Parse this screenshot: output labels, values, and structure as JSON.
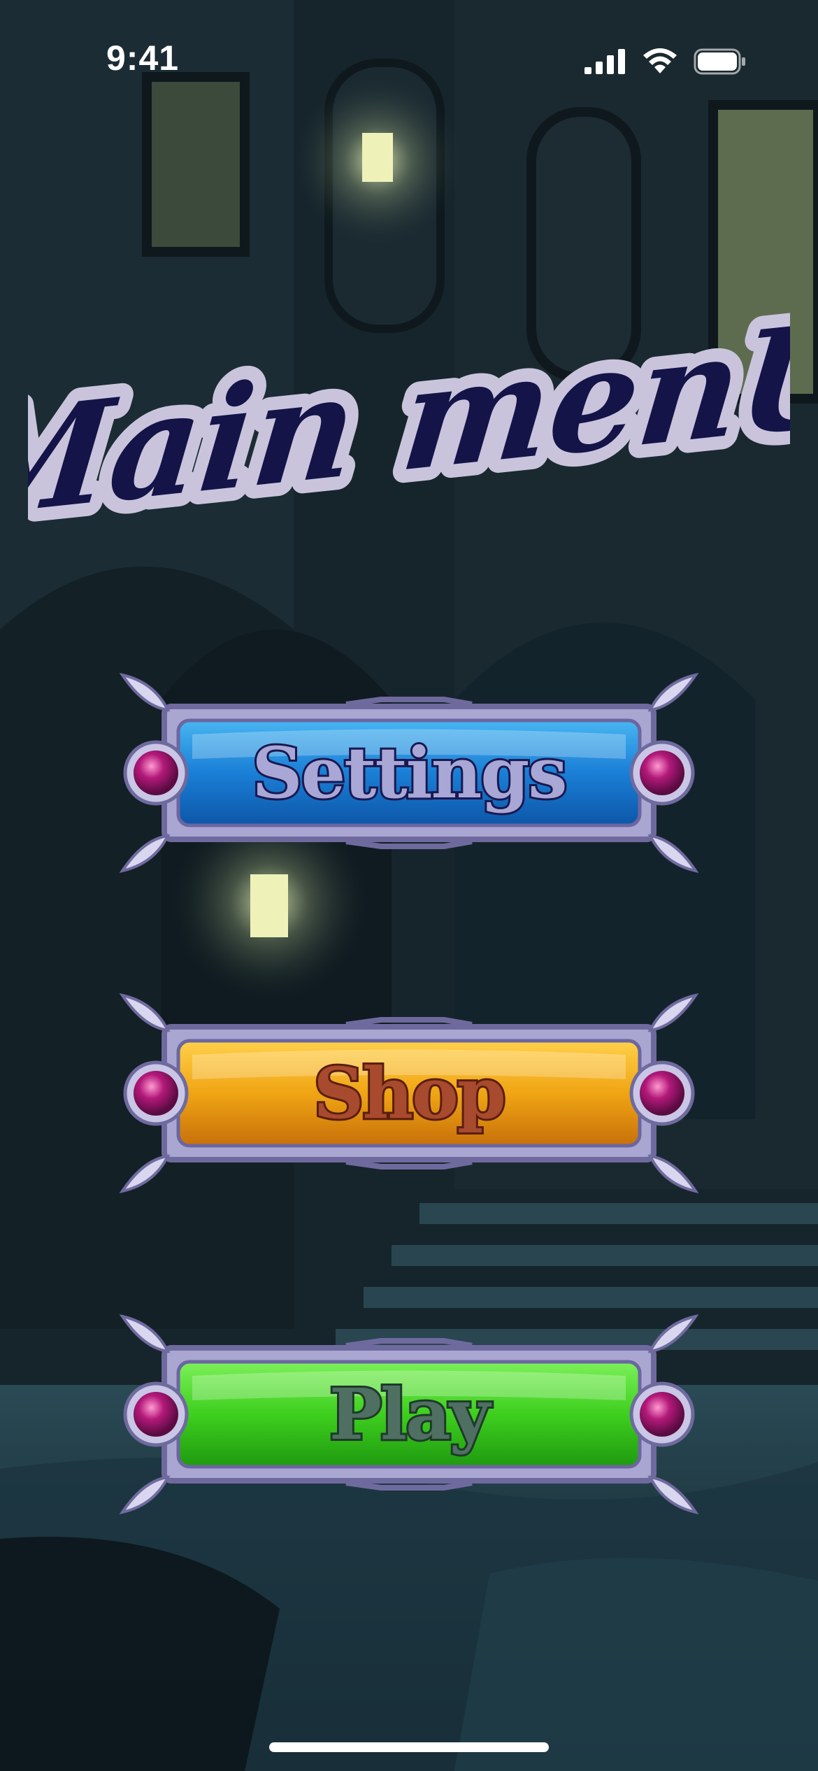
{
  "status_bar": {
    "time": "9:41",
    "icons": [
      "cellular-signal-icon",
      "wifi-icon",
      "battery-icon"
    ]
  },
  "title": {
    "text": "Main menU",
    "fill_color": "#141449",
    "outline_color": "#c9c4dc"
  },
  "menu": {
    "buttons": [
      {
        "label": "Settings",
        "color": "#1a7fd6"
      },
      {
        "label": "Shop",
        "color": "#f0a514"
      },
      {
        "label": "Play",
        "color": "#3ecf1e"
      }
    ]
  },
  "decor": {
    "frame_color": "#b7b2d8",
    "gem_color": "#b3197a",
    "background": "dark gothic courtyard with lamps"
  }
}
